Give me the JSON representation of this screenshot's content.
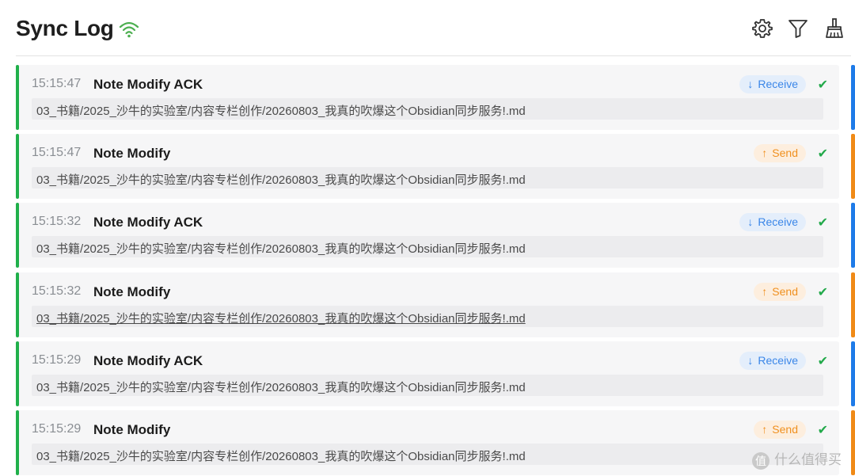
{
  "header": {
    "title": "Sync Log",
    "status_icon": "wifi-icon",
    "status_color": "#4caf50",
    "actions": [
      {
        "icon": "gear-icon"
      },
      {
        "icon": "filter-icon"
      },
      {
        "icon": "broom-icon"
      }
    ]
  },
  "colors": {
    "status_bar": "#20b04b",
    "receive": "#1e7be8",
    "send": "#f08a17",
    "success": "#22a94a"
  },
  "entries": [
    {
      "time": "15:15:47",
      "event": "Note Modify ACK",
      "direction": "Receive",
      "arrow": "↓",
      "path": "03_书籍/2025_沙牛的实验室/内容专栏创作/20260803_我真的吹爆这个Obsidian同步服务!.md",
      "status": "✔"
    },
    {
      "time": "15:15:47",
      "event": "Note Modify",
      "direction": "Send",
      "arrow": "↑",
      "path": "03_书籍/2025_沙牛的实验室/内容专栏创作/20260803_我真的吹爆这个Obsidian同步服务!.md",
      "status": "✔"
    },
    {
      "time": "15:15:32",
      "event": "Note Modify ACK",
      "direction": "Receive",
      "arrow": "↓",
      "path": "03_书籍/2025_沙牛的实验室/内容专栏创作/20260803_我真的吹爆这个Obsidian同步服务!.md",
      "status": "✔"
    },
    {
      "time": "15:15:32",
      "event": "Note Modify",
      "direction": "Send",
      "arrow": "↑",
      "path": "03_书籍/2025_沙牛的实验室/内容专栏创作/20260803_我真的吹爆这个Obsidian同步服务!.md",
      "status": "✔"
    },
    {
      "time": "15:15:29",
      "event": "Note Modify ACK",
      "direction": "Receive",
      "arrow": "↓",
      "path": "03_书籍/2025_沙牛的实验室/内容专栏创作/20260803_我真的吹爆这个Obsidian同步服务!.md",
      "status": "✔"
    },
    {
      "time": "15:15:29",
      "event": "Note Modify",
      "direction": "Send",
      "arrow": "↑",
      "path": "03_书籍/2025_沙牛的实验室/内容专栏创作/20260803_我真的吹爆这个Obsidian同步服务!.md",
      "status": "✔"
    }
  ],
  "watermark": {
    "logo_text": "值",
    "text": "什么值得买"
  }
}
